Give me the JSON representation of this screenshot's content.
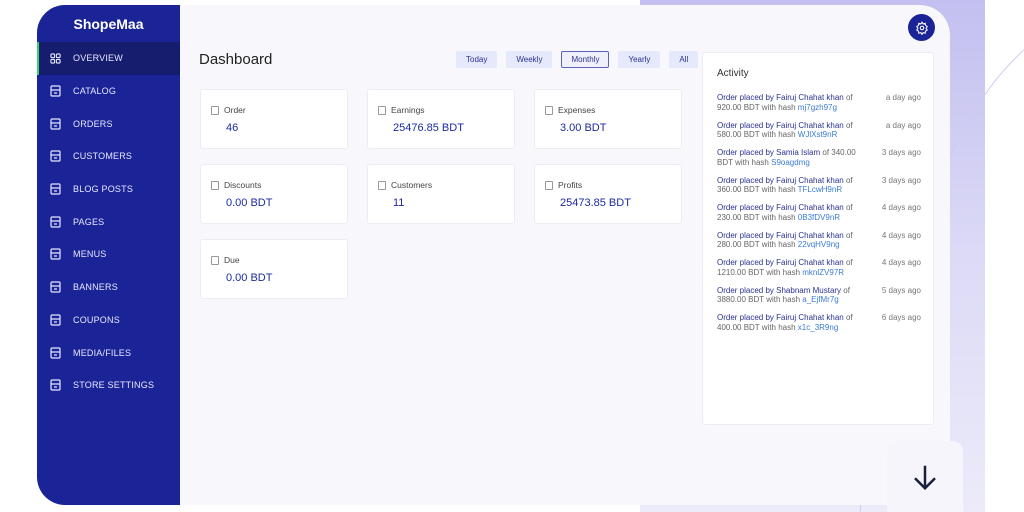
{
  "brand": "ShopeMaa",
  "nav": [
    "OVERVIEW",
    "CATALOG",
    "ORDERS",
    "CUSTOMERS",
    "BLOG POSTS",
    "PAGES",
    "MENUS",
    "BANNERS",
    "COUPONS",
    "MEDIA/FILES",
    "STORE SETTINGS"
  ],
  "title": "Dashboard",
  "filters": [
    "Today",
    "Weekly",
    "Monthly",
    "Yearly",
    "All"
  ],
  "active_filter": "Monthly",
  "cards": [
    {
      "label": "Order",
      "value": "46"
    },
    {
      "label": "Earnings",
      "value": "25476.85 BDT"
    },
    {
      "label": "Expenses",
      "value": "3.00 BDT"
    },
    {
      "label": "Discounts",
      "value": "0.00 BDT"
    },
    {
      "label": "Customers",
      "value": "11"
    },
    {
      "label": "Profits",
      "value": "25473.85 BDT"
    },
    {
      "label": "Due",
      "value": "0.00 BDT"
    }
  ],
  "activity": {
    "title": "Activity",
    "items": [
      {
        "name": "Order placed by Fairuj Chahat khan",
        "rest": " of 920.00 BDT with hash ",
        "hash": "mj7gzh97g",
        "time": "a day ago"
      },
      {
        "name": "Order placed by Fairuj Chahat khan",
        "rest": " of 580.00 BDT with hash ",
        "hash": "WJlXst9nR",
        "time": "a day ago"
      },
      {
        "name": "Order placed by Samia Islam",
        "rest": " of 340.00 BDT with hash ",
        "hash": "S9oagdmg",
        "time": "3 days ago"
      },
      {
        "name": "Order placed by Fairuj Chahat khan",
        "rest": " of 360.00 BDT with hash ",
        "hash": "TFLcwH9nR",
        "time": "3 days ago"
      },
      {
        "name": "Order placed by Fairuj Chahat khan",
        "rest": " of 230.00 BDT with hash ",
        "hash": "0B3fDV9nR",
        "time": "4 days ago"
      },
      {
        "name": "Order placed by Fairuj Chahat khan",
        "rest": " of 280.00 BDT with hash ",
        "hash": "22vqHV9ng",
        "time": "4 days ago"
      },
      {
        "name": "Order placed by Fairuj Chahat khan",
        "rest": " of 1210.00 BDT with hash ",
        "hash": "mknlZV97R",
        "time": "4 days ago"
      },
      {
        "name": "Order placed by Shabnam Mustary",
        "rest": " of 3880.00 BDT with hash ",
        "hash": "a_EjfMr7g",
        "time": "5 days ago"
      },
      {
        "name": "Order placed by Fairuj Chahat khan",
        "rest": " of 400.00 BDT with hash ",
        "hash": "x1c_3R9ng",
        "time": "6 days ago"
      }
    ]
  }
}
